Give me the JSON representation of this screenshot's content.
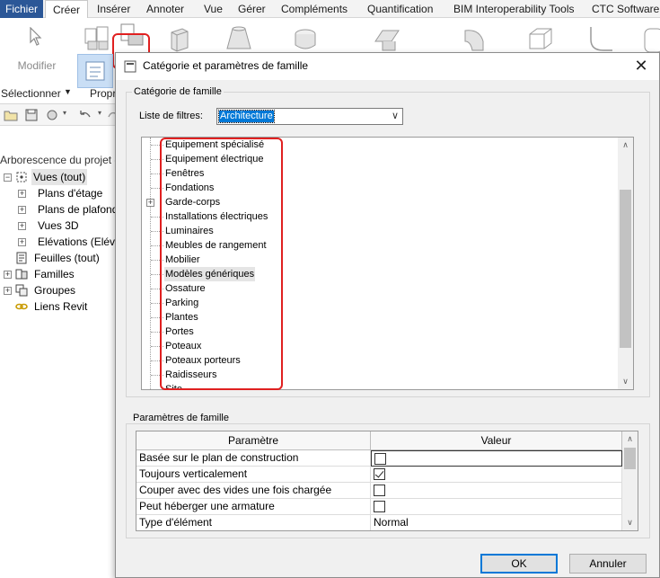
{
  "ribbon": {
    "tabs": [
      "Fichier",
      "Créer",
      "Insérer",
      "Annoter",
      "Vue",
      "Gérer",
      "Compléments",
      "Quantification",
      "BIM Interoperability Tools",
      "CTC Software"
    ],
    "active_tab": "Créer",
    "modify_label": "Modifier",
    "select_label": "Sélectionner",
    "properties_label": "Propr"
  },
  "project_browser": {
    "title": "Arborescence du projet -",
    "items": [
      {
        "label": "Vues (tout)",
        "level": 0
      },
      {
        "label": "Plans d'étage",
        "level": 1
      },
      {
        "label": "Plans de plafond",
        "level": 1
      },
      {
        "label": "Vues 3D",
        "level": 1
      },
      {
        "label": "Elévations (Elév",
        "level": 1
      },
      {
        "label": "Feuilles (tout)",
        "level": 0
      },
      {
        "label": "Familles",
        "level": 0
      },
      {
        "label": "Groupes",
        "level": 0
      },
      {
        "label": "Liens Revit",
        "level": 0
      }
    ]
  },
  "dialog": {
    "title": "Catégorie et paramètres de famille",
    "category_group_label": "Catégorie de famille",
    "filter_label": "Liste de filtres:",
    "filter_value": "Architecture",
    "categories": [
      "Equipement spécialisé",
      "Equipement électrique",
      "Fenêtres",
      "Fondations",
      "Garde-corps",
      "Installations électriques",
      "Luminaires",
      "Meubles de rangement",
      "Mobilier",
      "Modèles génériques",
      "Ossature",
      "Parking",
      "Plantes",
      "Portes",
      "Poteaux",
      "Poteaux porteurs",
      "Raidisseurs",
      "Site"
    ],
    "selected_category": "Modèles génériques",
    "params_group_label": "Paramètres de famille",
    "params_header": {
      "param": "Paramètre",
      "value": "Valeur"
    },
    "params": [
      {
        "name": "Basée sur le plan de construction",
        "checked": false
      },
      {
        "name": "Toujours verticalement",
        "checked": true
      },
      {
        "name": "Couper avec des vides une fois chargée",
        "checked": false
      },
      {
        "name": "Peut héberger une armature",
        "checked": false
      },
      {
        "name": "Type d'élément",
        "value": "Normal"
      }
    ],
    "ok_label": "OK",
    "cancel_label": "Annuler"
  }
}
